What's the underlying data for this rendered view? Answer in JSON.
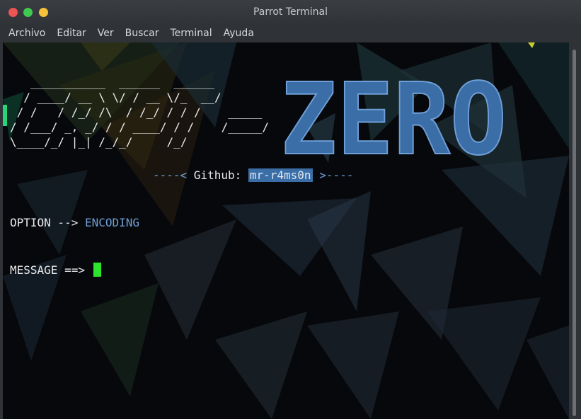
{
  "window": {
    "title": "Parrot Terminal"
  },
  "menu": {
    "items": [
      "Archivo",
      "Editar",
      "Ver",
      "Buscar",
      "Terminal",
      "Ayuda"
    ]
  },
  "terminal": {
    "ascii_banner": "   ___________  ______  ______\n  / ____/ __ \\ \\/ / __ \\/_  __/\n / /   / /_/ /\\  / /_/ / / /    _____\n/ /___/ _, _/ / / ____/ / /    /_____/\n\\____/_/ |_| /_/_/     /_/",
    "logo_text": "ZERO",
    "github": {
      "prefix": "----< ",
      "label": "Github: ",
      "user": "mr-r4ms0n",
      "suffix": " >----"
    },
    "option": {
      "label": "OPTION --> ",
      "value": "ENCODING"
    },
    "message": {
      "prompt": "MESSAGE ==> "
    }
  },
  "colors": {
    "accent_blue": "#3b6ea6",
    "cursor_green": "#2ee52e",
    "terminal_bg": "#07080b"
  }
}
